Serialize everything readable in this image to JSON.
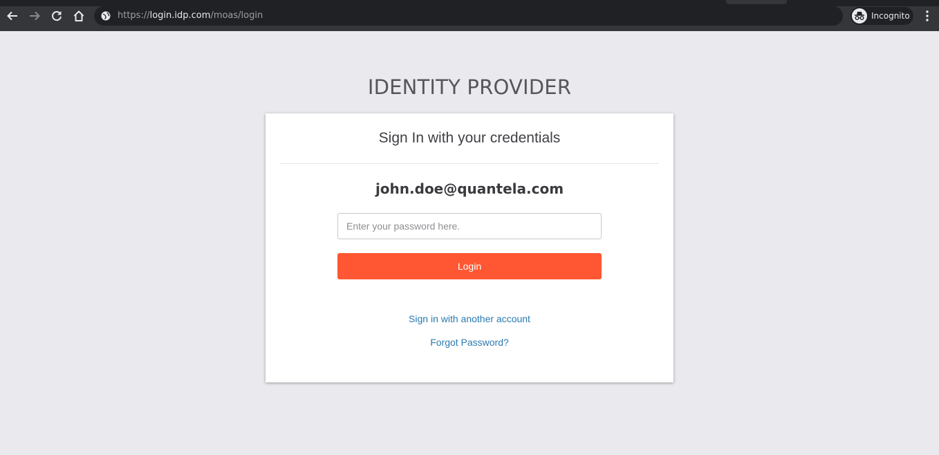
{
  "browser": {
    "url_scheme": "https://",
    "url_host": "login.idp.com",
    "url_path": "/moas/login",
    "incognito_label": "Incognito",
    "icons": [
      "back-icon",
      "forward-icon",
      "reload-icon",
      "home-icon",
      "globe-icon",
      "incognito-icon",
      "kebab-menu-icon"
    ],
    "colors": {
      "toolbar": "#35363a",
      "omnibox": "#202124"
    }
  },
  "page": {
    "brand_title": "IDENTITY PROVIDER",
    "card_title": "Sign In with your credentials",
    "user_email": "john.doe@quantela.com",
    "password_placeholder": "Enter your password here.",
    "password_value": "",
    "login_label": "Login",
    "another_account_link": "Sign in with another account",
    "forgot_password_link": "Forgot Password?",
    "colors": {
      "accent": "#ff5733",
      "link": "#2a79b0",
      "background": "#e9e9ee"
    }
  }
}
